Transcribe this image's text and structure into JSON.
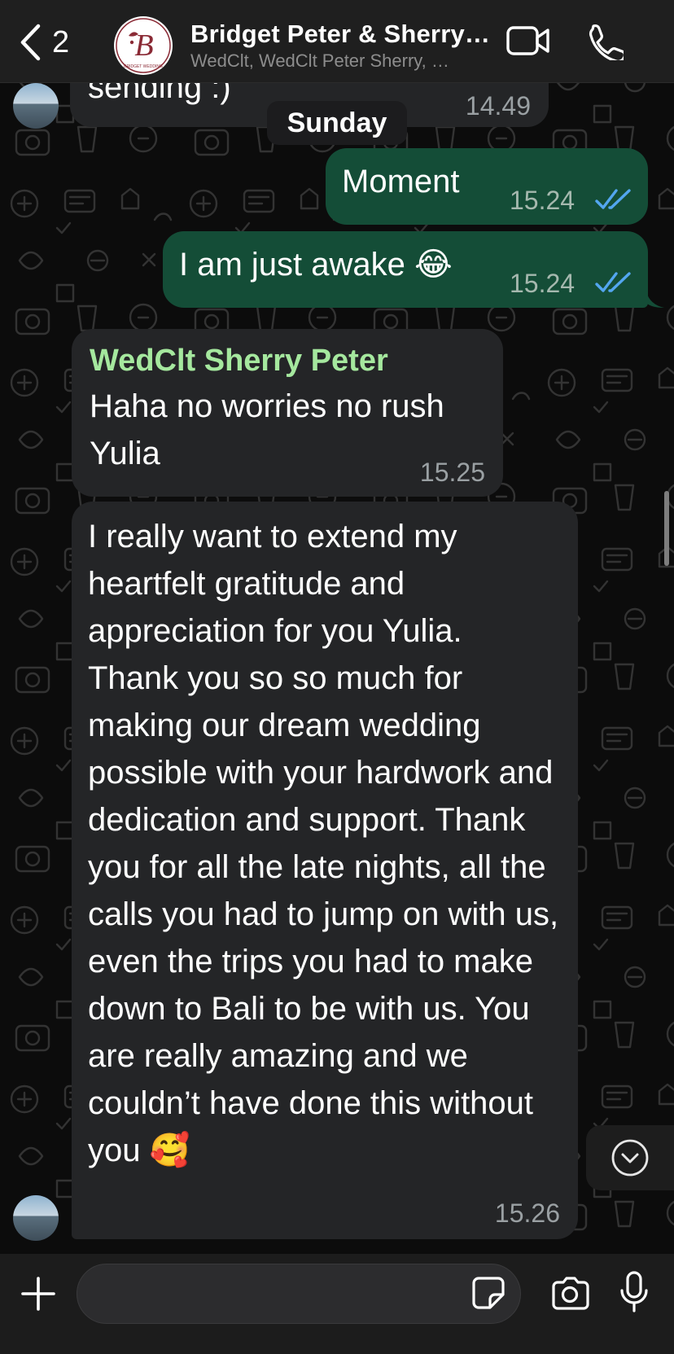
{
  "header": {
    "back_count": "2",
    "group_name": "Bridget Peter & Sherry…",
    "group_members": "WedClt, WedClt Peter Sherry, …",
    "avatar_letter": "B",
    "avatar_caption": "BRIDGET WEDDING"
  },
  "date_separator": "Sunday",
  "messages": [
    {
      "direction": "in",
      "text": "sending :)",
      "time": "14.49"
    },
    {
      "direction": "out",
      "text": "Moment",
      "time": "15.24",
      "status": "read"
    },
    {
      "direction": "out",
      "text": "I am just awake 😂",
      "time": "15.24",
      "status": "read"
    },
    {
      "direction": "in",
      "sender": "WedClt Sherry Peter",
      "text": "Haha no worries no rush Yulia",
      "time": "15.25"
    },
    {
      "direction": "in",
      "text": "I really want to extend my heartfelt gratitude and appreciation for you Yulia. Thank you so so much for making our dream wedding possible with your hardwork and dedication and support. Thank you for all the late nights, all the calls you had to jump on with us, even the trips you had to make down to Bali to be with us. You are really amazing and we couldn’t have done this without you 🥰",
      "time": "15.26"
    }
  ],
  "colors": {
    "outgoing_bubble": "#144d37",
    "incoming_bubble": "#242527",
    "sender_name": "#a5e89e",
    "read_ticks": "#53a6f0",
    "header_bg": "#1f1f1f"
  },
  "icons": {
    "back": "chevron-left-icon",
    "video": "video-camera-icon",
    "call": "phone-icon",
    "attach": "plus-icon",
    "sticker": "sticker-icon",
    "camera": "camera-icon",
    "mic": "microphone-icon",
    "scroll_down": "chevron-down-circle-icon"
  }
}
